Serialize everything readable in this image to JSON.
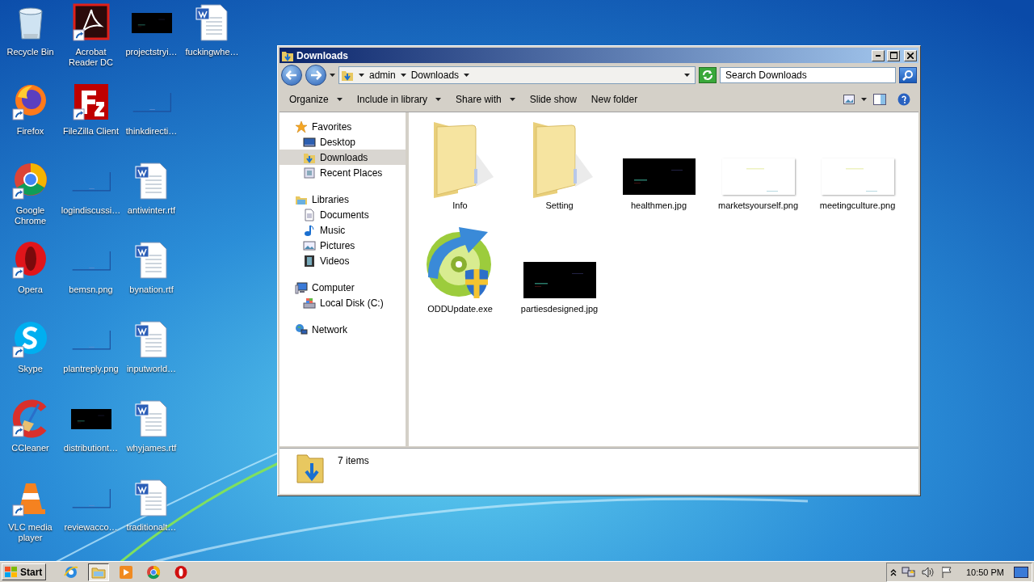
{
  "desktop": {
    "columns": [
      [
        {
          "label": "Recycle Bin",
          "kind": "recycle",
          "shortcut": false
        },
        {
          "label": "Firefox",
          "kind": "firefox",
          "shortcut": true
        },
        {
          "label": "Google Chrome",
          "kind": "chrome",
          "shortcut": true
        },
        {
          "label": "Opera",
          "kind": "opera",
          "shortcut": true
        },
        {
          "label": "Skype",
          "kind": "skype",
          "shortcut": true
        },
        {
          "label": "CCleaner",
          "kind": "ccleaner",
          "shortcut": true
        },
        {
          "label": "VLC media player",
          "kind": "vlc",
          "shortcut": true
        }
      ],
      [
        {
          "label": "Acrobat Reader DC",
          "kind": "acrobat",
          "shortcut": true
        },
        {
          "label": "FileZilla Client",
          "kind": "filezilla",
          "shortcut": true
        },
        {
          "label": "logindiscussi…",
          "kind": "blank",
          "shortcut": false
        },
        {
          "label": "bemsn.png",
          "kind": "blank",
          "shortcut": false
        },
        {
          "label": "plantreply.png",
          "kind": "blank",
          "shortcut": false
        },
        {
          "label": "distributiont…",
          "kind": "dark",
          "shortcut": false
        },
        {
          "label": "reviewacco…",
          "kind": "blank",
          "shortcut": false
        }
      ],
      [
        {
          "label": "projectstryi…",
          "kind": "dark",
          "shortcut": false
        },
        {
          "label": "thinkdirecti…",
          "kind": "blank",
          "shortcut": false
        },
        {
          "label": "antiwinter.rtf",
          "kind": "word",
          "shortcut": false
        },
        {
          "label": "bynation.rtf",
          "kind": "word",
          "shortcut": false
        },
        {
          "label": "inputworld…",
          "kind": "word",
          "shortcut": false
        },
        {
          "label": "whyjames.rtf",
          "kind": "word",
          "shortcut": false
        },
        {
          "label": "traditionalt…",
          "kind": "word",
          "shortcut": false
        }
      ],
      [
        {
          "label": "fuckingwhe…",
          "kind": "word",
          "shortcut": false
        }
      ]
    ]
  },
  "window": {
    "title": "Downloads",
    "breadcrumb": [
      "admin",
      "Downloads"
    ],
    "search": {
      "placeholder": "Search Downloads"
    },
    "toolbar": [
      {
        "label": "Organize",
        "dropdown": true
      },
      {
        "label": "Include in library",
        "dropdown": true
      },
      {
        "label": "Share with",
        "dropdown": true
      },
      {
        "label": "Slide show",
        "dropdown": false
      },
      {
        "label": "New folder",
        "dropdown": false
      }
    ],
    "nav": [
      {
        "label": "Favorites",
        "kind": "star",
        "selected": false,
        "children": [
          {
            "label": "Desktop",
            "kind": "desktop",
            "selected": false
          },
          {
            "label": "Downloads",
            "kind": "downloads",
            "selected": true
          },
          {
            "label": "Recent Places",
            "kind": "recent",
            "selected": false
          }
        ]
      },
      {
        "label": "Libraries",
        "kind": "libraries",
        "selected": false,
        "children": [
          {
            "label": "Documents",
            "kind": "documents",
            "selected": false
          },
          {
            "label": "Music",
            "kind": "music",
            "selected": false
          },
          {
            "label": "Pictures",
            "kind": "pictures",
            "selected": false
          },
          {
            "label": "Videos",
            "kind": "videos",
            "selected": false
          }
        ]
      },
      {
        "label": "Computer",
        "kind": "computer",
        "selected": false,
        "children": [
          {
            "label": "Local Disk (C:)",
            "kind": "disk",
            "selected": false
          }
        ]
      },
      {
        "label": "Network",
        "kind": "network",
        "selected": false
      }
    ],
    "files": [
      {
        "name": "Info",
        "kind": "folder"
      },
      {
        "name": "Setting",
        "kind": "folder"
      },
      {
        "name": "healthmen.jpg",
        "kind": "dark"
      },
      {
        "name": "marketsyourself.png",
        "kind": "light"
      },
      {
        "name": "meetingculture.png",
        "kind": "light"
      },
      {
        "name": "ODDUpdate.exe",
        "kind": "exe"
      },
      {
        "name": "partiesdesigned.jpg",
        "kind": "dark"
      }
    ],
    "status": "7 items"
  },
  "taskbar": {
    "start": "Start",
    "apps": [
      {
        "kind": "ie",
        "selected": false
      },
      {
        "kind": "explorer",
        "selected": true
      },
      {
        "kind": "media",
        "selected": false
      },
      {
        "kind": "chrome",
        "selected": false
      },
      {
        "kind": "opera",
        "selected": false
      }
    ],
    "time": "10:50 PM"
  }
}
